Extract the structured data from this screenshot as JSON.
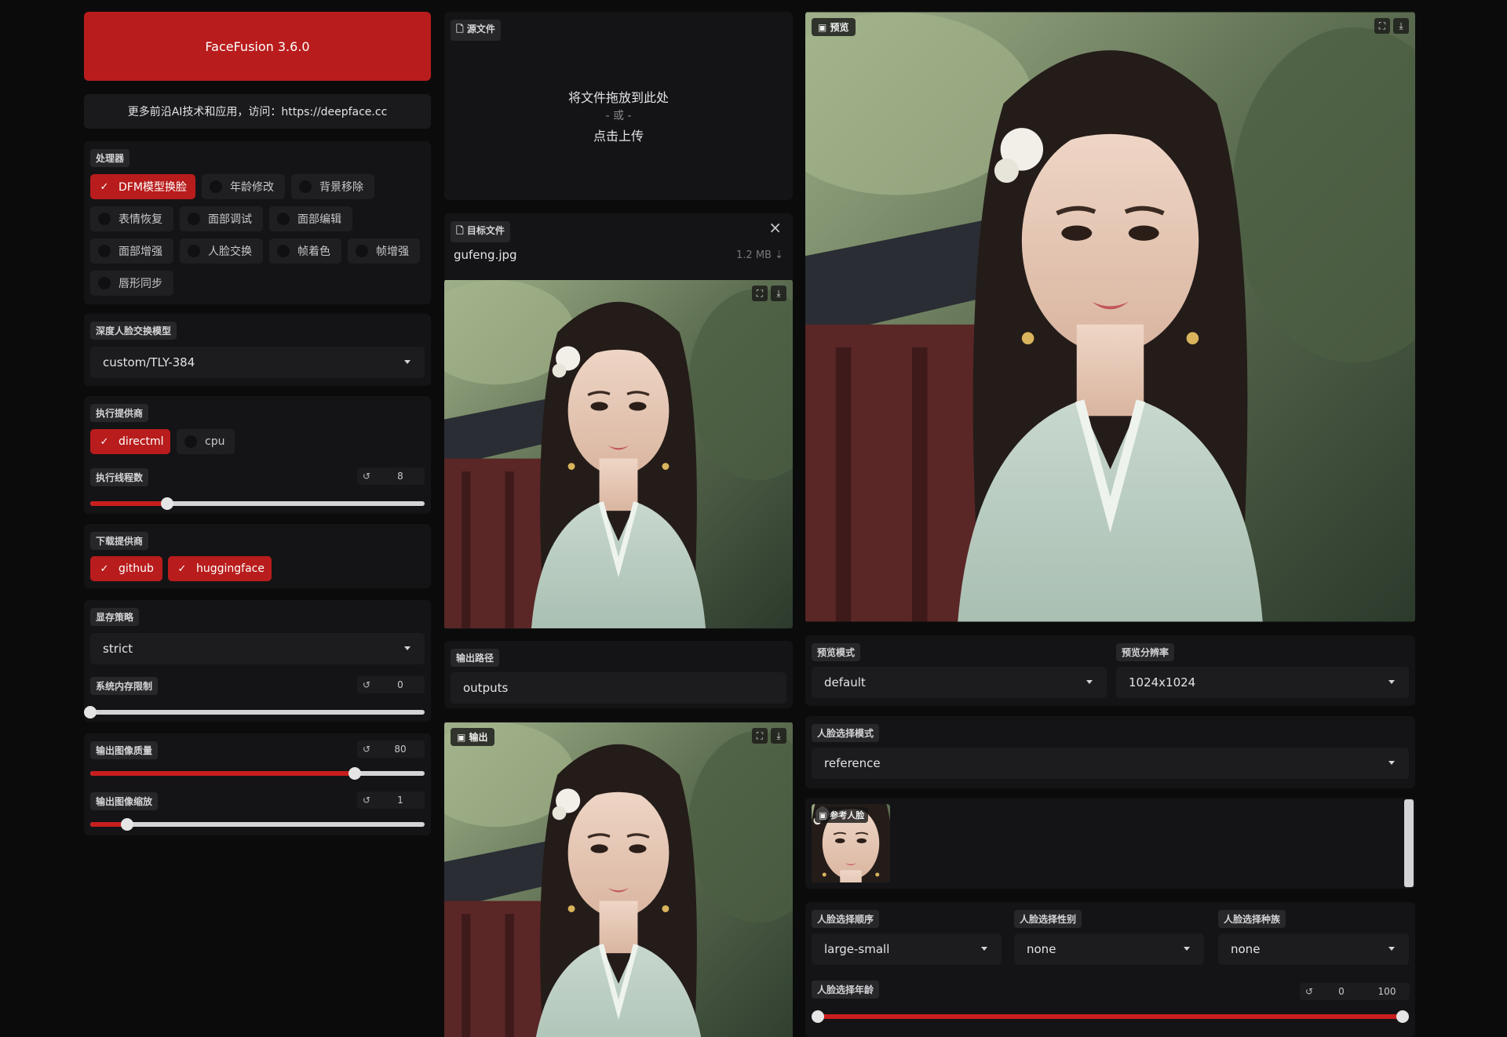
{
  "app": {
    "title": "FaceFusion 3.6.0",
    "notice": "更多前沿AI技术和应用，访问：https://deepface.cc"
  },
  "processors": {
    "label": "处理器",
    "items": [
      {
        "label": "DFM模型换脸",
        "checked": true
      },
      {
        "label": "年龄修改",
        "checked": false
      },
      {
        "label": "背景移除",
        "checked": false
      },
      {
        "label": "表情恢复",
        "checked": false
      },
      {
        "label": "面部调试",
        "checked": false
      },
      {
        "label": "面部编辑",
        "checked": false
      },
      {
        "label": "面部增强",
        "checked": false
      },
      {
        "label": "人脸交换",
        "checked": false
      },
      {
        "label": "帧着色",
        "checked": false
      },
      {
        "label": "帧增强",
        "checked": false
      },
      {
        "label": "唇形同步",
        "checked": false
      }
    ]
  },
  "deep_swapper": {
    "label": "深度人脸交换模型",
    "value": "custom/TLY-384"
  },
  "execution": {
    "label": "执行提供商",
    "providers": [
      {
        "label": "directml",
        "checked": true
      },
      {
        "label": "cpu",
        "checked": false
      }
    ],
    "threads_label": "执行线程数",
    "threads_value": "8",
    "threads_fraction": 0.23
  },
  "download": {
    "label": "下载提供商",
    "providers": [
      {
        "label": "github",
        "checked": true
      },
      {
        "label": "huggingface",
        "checked": true
      }
    ]
  },
  "memory": {
    "label": "显存策略",
    "value": "strict",
    "limit_label": "系统内存限制",
    "limit_value": "0",
    "limit_fraction": 0
  },
  "output_image": {
    "quality_label": "输出图像质量",
    "quality_value": "80",
    "quality_fraction": 0.79,
    "scale_label": "输出图像缩放",
    "scale_value": "1",
    "scale_fraction": 0.11
  },
  "source": {
    "label": "源文件",
    "drop_text": "将文件拖放到此处",
    "or_text": "- 或 -",
    "click_text": "点击上传"
  },
  "target": {
    "label": "目标文件",
    "filename": "gufeng.jpg",
    "size": "1.2 MB ⇣",
    "close": "×"
  },
  "output_path": {
    "label": "输出路径",
    "value": "outputs"
  },
  "output": {
    "label": "输出"
  },
  "preview": {
    "label": "预览",
    "mode_label": "预览模式",
    "mode_value": "default",
    "resolution_label": "预览分辨率",
    "resolution_value": "1024x1024"
  },
  "face_selector": {
    "mode_label": "人脸选择模式",
    "mode_value": "reference",
    "reference_label": "参考人脸",
    "order_label": "人脸选择顺序",
    "order_value": "large-small",
    "gender_label": "人脸选择性别",
    "gender_value": "none",
    "race_label": "人脸选择种族",
    "race_value": "none",
    "age_label": "人脸选择年龄",
    "age_min": "0",
    "age_max": "100",
    "age_min_fraction": 0,
    "age_max_fraction": 1
  },
  "icons": {
    "reset": "↺",
    "fullscreen": "⛶",
    "download": "⤓",
    "check": "✓",
    "file": "🗋",
    "image": "▣"
  },
  "colors": {
    "accent": "#c81e1e",
    "panel": "#141416",
    "background": "#0b0b0c"
  }
}
